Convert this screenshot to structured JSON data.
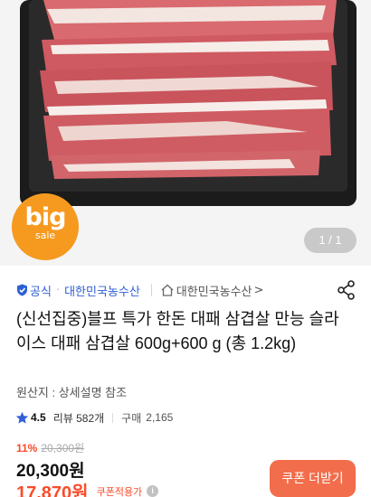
{
  "hero": {
    "badge_big": "big",
    "badge_sale": "sale",
    "page_counter": "1 / 1"
  },
  "seller": {
    "official_label": "공식",
    "name": "대한민국농수산",
    "store_name": "대한민국농수산",
    "store_chevron": ">"
  },
  "product": {
    "title": "(신선집중)블프 특가 한돈 대패 삼겹살 만능 슬라이스 대패 삼겹살 600g+600 g (총 1.2kg)",
    "origin": "원산지 : 상세설명 참조"
  },
  "rating": {
    "score": "4.5",
    "review_text": "리뷰 582개",
    "purchase_label": "구매",
    "purchase_count": "2,165"
  },
  "price": {
    "discount_rate": "11%",
    "original_price": "20,300원",
    "sale_price": "20,300원",
    "coupon_price": "17,870원",
    "coupon_applied_label": "쿠폰적용가",
    "info_icon": "i"
  },
  "actions": {
    "coupon_button": "쿠폰 더받기"
  },
  "colors": {
    "accent_red": "#fa4b2a",
    "link_blue": "#2f5fd6",
    "badge_orange": "#f59a1f",
    "coupon_button_bg": "#f26d4b"
  },
  "icons": {
    "official": "shield-check-icon",
    "store": "house-icon",
    "share": "share-icon",
    "star": "star-icon"
  }
}
